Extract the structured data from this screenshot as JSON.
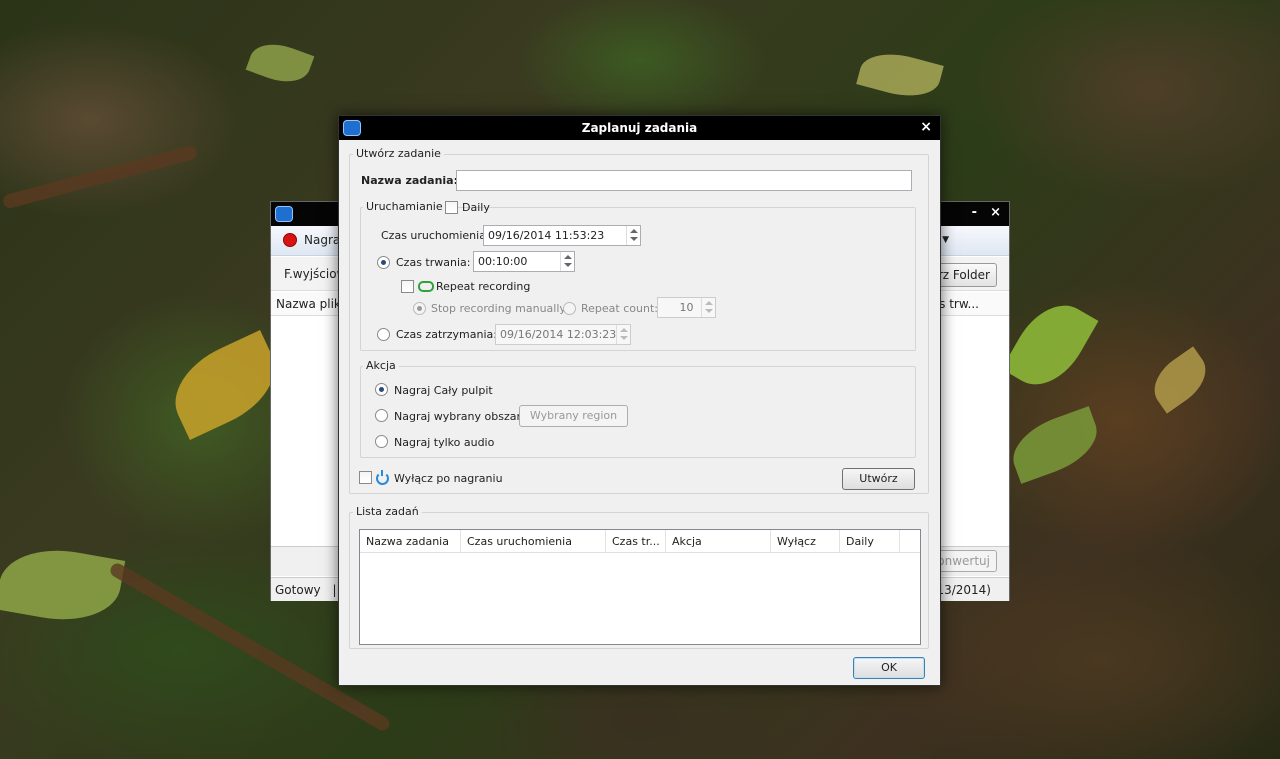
{
  "background_window": {
    "record_label": "Nagraj",
    "output_label": "F.wyjściow",
    "folder_button": "órz Folder",
    "column_name": "Nazwa pliku",
    "column_right": "s trw...",
    "convert_button": "onwertuj",
    "status_left": "Gotowy",
    "status_sep": "|",
    "status_date": "2/13/2014)",
    "minimize": "-",
    "close": "×"
  },
  "dialog": {
    "title": "Zaplanuj zadania",
    "close": "×",
    "create_group": {
      "legend": "Utwórz zadanie",
      "name_label": "Nazwa zadania:",
      "name_value": "",
      "launch_group": {
        "legend": "Uruchamianie",
        "daily_label": "Daily",
        "daily_checked": false,
        "start_time_label": "Czas uruchomienia:",
        "start_time_value": "09/16/2014 11:53:23",
        "duration_label": "Czas trwania:",
        "duration_value": "00:10:00",
        "repeat_label": "Repeat recording",
        "stop_manual_label": "Stop recording manually",
        "repeat_count_label": "Repeat count:",
        "repeat_count_value": "10",
        "stop_time_label": "Czas zatrzymania:",
        "stop_time_value": "09/16/2014 12:03:23"
      },
      "action_group": {
        "legend": "Akcja",
        "record_desktop": "Nagraj Cały pulpit",
        "record_region": "Nagraj wybrany obszar",
        "region_button": "Wybrany region",
        "record_audio": "Nagraj tylko audio"
      },
      "shutdown_label": "Wyłącz po nagraniu",
      "create_button": "Utwórz"
    },
    "list_group": {
      "legend": "Lista zadań",
      "columns": [
        "Nazwa zadania",
        "Czas uruchomienia",
        "Czas tr...",
        "Akcja",
        "Wyłącz",
        "Daily"
      ]
    },
    "ok_button": "OK"
  }
}
